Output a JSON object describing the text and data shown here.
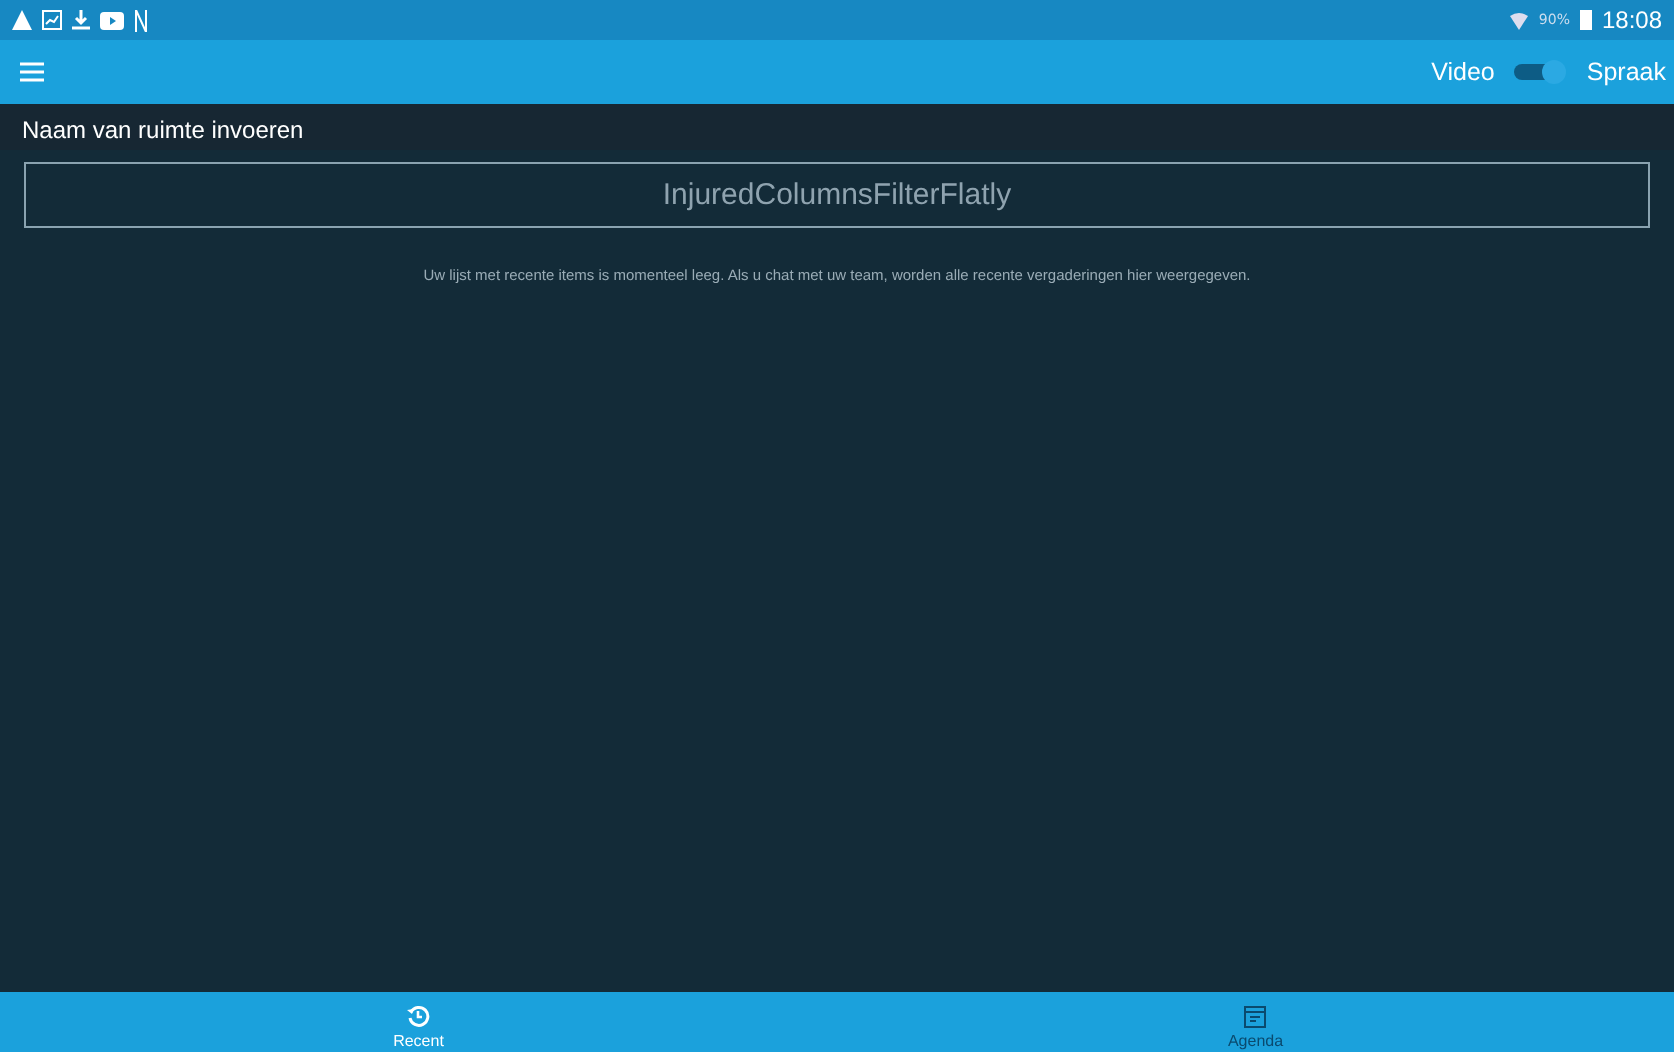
{
  "status_bar": {
    "battery": "90%",
    "time": "18:08"
  },
  "app_bar": {
    "mode_left": "Video",
    "mode_right": "Spraak",
    "toggle": {
      "on": true
    }
  },
  "room_field": {
    "label": "Naam van ruimte invoeren",
    "value": "InjuredColumnsFilterFlatly"
  },
  "empty_message": "Uw lijst met recente items is momenteel leeg. Als u chat met uw team, worden alle recente vergaderingen hier weergegeven.",
  "tabs": [
    {
      "label": "Recent",
      "kind": "history",
      "selected": true
    },
    {
      "label": "Agenda",
      "kind": "calendar",
      "selected": false
    }
  ]
}
